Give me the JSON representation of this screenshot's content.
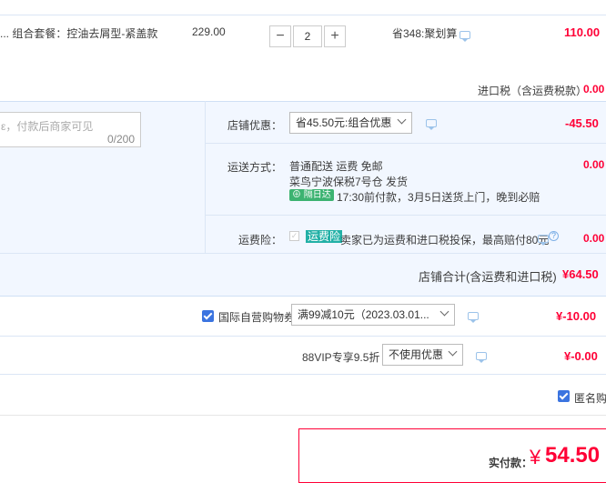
{
  "item": {
    "description": "... 组合套餐：控油去屑型-紧盖款",
    "price": "229.00",
    "quantity": "2",
    "minus_glyph": "−",
    "plus_glyph": "+",
    "saving": "省348:聚划算",
    "subtotal": "110.00"
  },
  "import_tax": {
    "label": "进口税（含运费税款）",
    "value": "0.00"
  },
  "message": {
    "placeholder": "ε，付款后商家可见",
    "counter": "0/200"
  },
  "shop_discount": {
    "label": "店铺优惠：",
    "selected": "省45.50元:组合优惠",
    "value": "-45.50"
  },
  "shipping": {
    "label": "运送方式：",
    "line1": "普通配送 运费 免邮",
    "line2": "菜鸟宁波保税7号仓  发货",
    "badge": "⊕ 隔日达",
    "line3": "17:30前付款，3月5日送货上门，晚到必赔",
    "value": "0.00"
  },
  "insurance": {
    "label": "运费险：",
    "badge": "运费险",
    "text": "卖家已为运费和进口税投保，最高赔付80元",
    "help": "?",
    "value": "0.00"
  },
  "shop_total": {
    "label": "店铺合计(含运费和进口税)",
    "value": "¥64.50"
  },
  "coupon": {
    "checkbox_label": "国际自营购物券",
    "selected": "满99减10元（2023.03.01...",
    "value": "¥-10.00"
  },
  "vip": {
    "label": "88VIP专享9.5折",
    "selected": "不使用优惠",
    "value": "¥-0.00"
  },
  "anonymous": {
    "label": "匿名购买"
  },
  "payment": {
    "label": "实付款：",
    "currency": "¥",
    "amount": "54.50"
  },
  "colors": {
    "accent_red": "#ff0036",
    "panel_blue": "#f2f7ff",
    "checkbox_blue": "#3b74e0",
    "badge_green": "#3cb371",
    "badge_teal": "#22b0a6"
  }
}
